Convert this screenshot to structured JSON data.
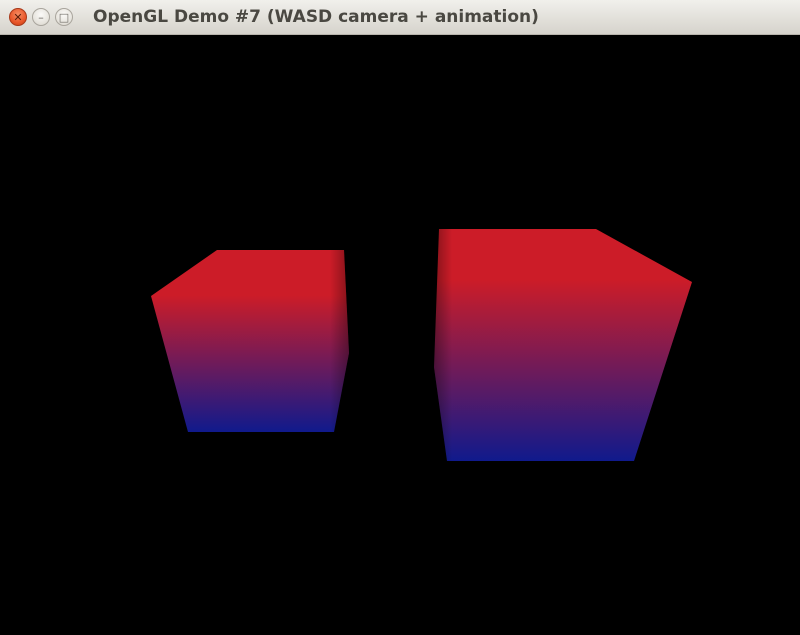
{
  "window": {
    "title": "OpenGL Demo #7 (WASD camera + animation)",
    "controls": {
      "close_glyph": "✕",
      "minimize_glyph": "–",
      "maximize_glyph": "□"
    }
  },
  "scene": {
    "background_color": "#000000",
    "cube_top_color": "#cc1c28",
    "cube_bottom_color": "#101a8c",
    "cube_count": 2
  }
}
